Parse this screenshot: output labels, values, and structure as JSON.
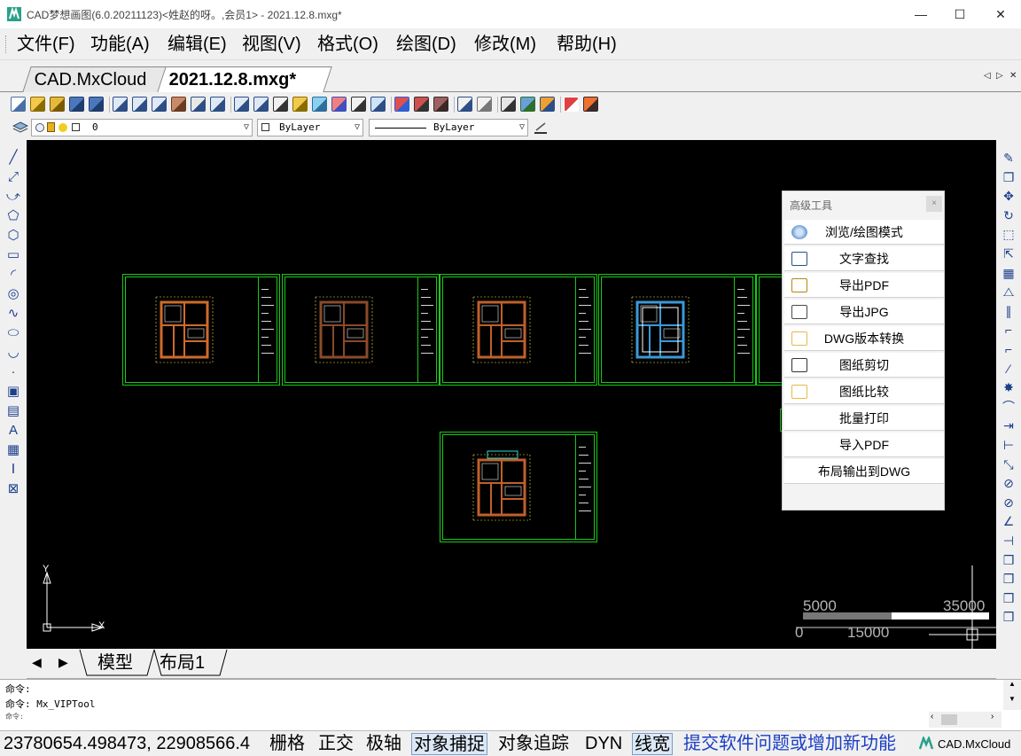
{
  "window": {
    "title": "CAD梦想画图(6.0.20211123)<姓赵的呀。,会员1>  - 2021.12.8.mxg*",
    "minimize": "—",
    "maximize": "☐",
    "close": "✕"
  },
  "menu": [
    "文件(F)",
    "功能(A)",
    "编辑(E)",
    "视图(V)",
    "格式(O)",
    "绘图(D)",
    "修改(M)",
    "帮助(H)"
  ],
  "tabs": {
    "inactive": "CAD.MxCloud",
    "active": "2021.12.8.mxg*",
    "scroll_left": "◁",
    "scroll_right": "▷",
    "close": "✕"
  },
  "layer_toolbar": {
    "layer_value": "0",
    "color_value": "ByLayer",
    "linetype_value": "ByLayer"
  },
  "canvas": {
    "bg": "#000000",
    "ucs_y": "Y",
    "ucs_x": "X",
    "scale_top_left": "5000",
    "scale_top_right": "35000",
    "scale_bottom_left": "0",
    "scale_bottom_right": "15000"
  },
  "advanced_tools": {
    "title": "高级工具",
    "close": "×",
    "buttons": [
      "浏览/绘图模式",
      "文字查找",
      "导出PDF",
      "导出JPG",
      "DWG版本转换",
      "图纸剪切",
      "图纸比较",
      "批量打印",
      "导入PDF",
      "布局输出到DWG"
    ]
  },
  "layout_tabs": {
    "prev": "◀",
    "next": "▶",
    "model": "模型",
    "layout1": "布局1"
  },
  "command": {
    "line1": "命令:",
    "line2": "命令: Mx_VIPTool",
    "line3": "命令:"
  },
  "status": {
    "coords": "23780654.498473,  22908566.4",
    "grid": "栅格",
    "ortho": "正交",
    "polar": "极轴",
    "osnap": "对象捕捉",
    "otrack": "对象追踪",
    "dyn": "DYN",
    "lwt": "线宽",
    "feedback": "提交软件问题或增加新功能",
    "brand": "CAD.MxCloud"
  },
  "colors": {
    "accent_green": "#19c819",
    "link_blue": "#1a3fc4"
  }
}
